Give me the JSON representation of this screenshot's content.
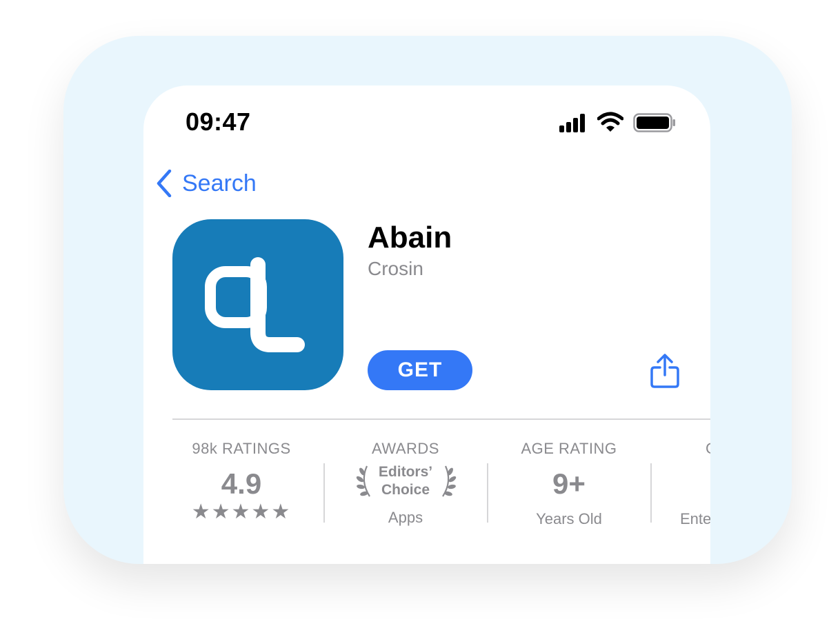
{
  "status_bar": {
    "time": "09:47"
  },
  "nav": {
    "back_label": "Search"
  },
  "app": {
    "name": "Abain",
    "developer": "Crosin",
    "get_label": "GET",
    "icon_color": "#177cb8",
    "accent_color": "#3478f6"
  },
  "info": {
    "ratings": {
      "header": "98k RATINGS",
      "value": "4.9",
      "stars": "★★★★★"
    },
    "awards": {
      "header": "AWARDS",
      "line1": "Editors’",
      "line2": "Choice",
      "sub": "Apps"
    },
    "age": {
      "header": "AGE RATING",
      "value": "9+",
      "sub": "Years Old"
    },
    "category": {
      "header": "C",
      "sub": "Ente"
    }
  }
}
